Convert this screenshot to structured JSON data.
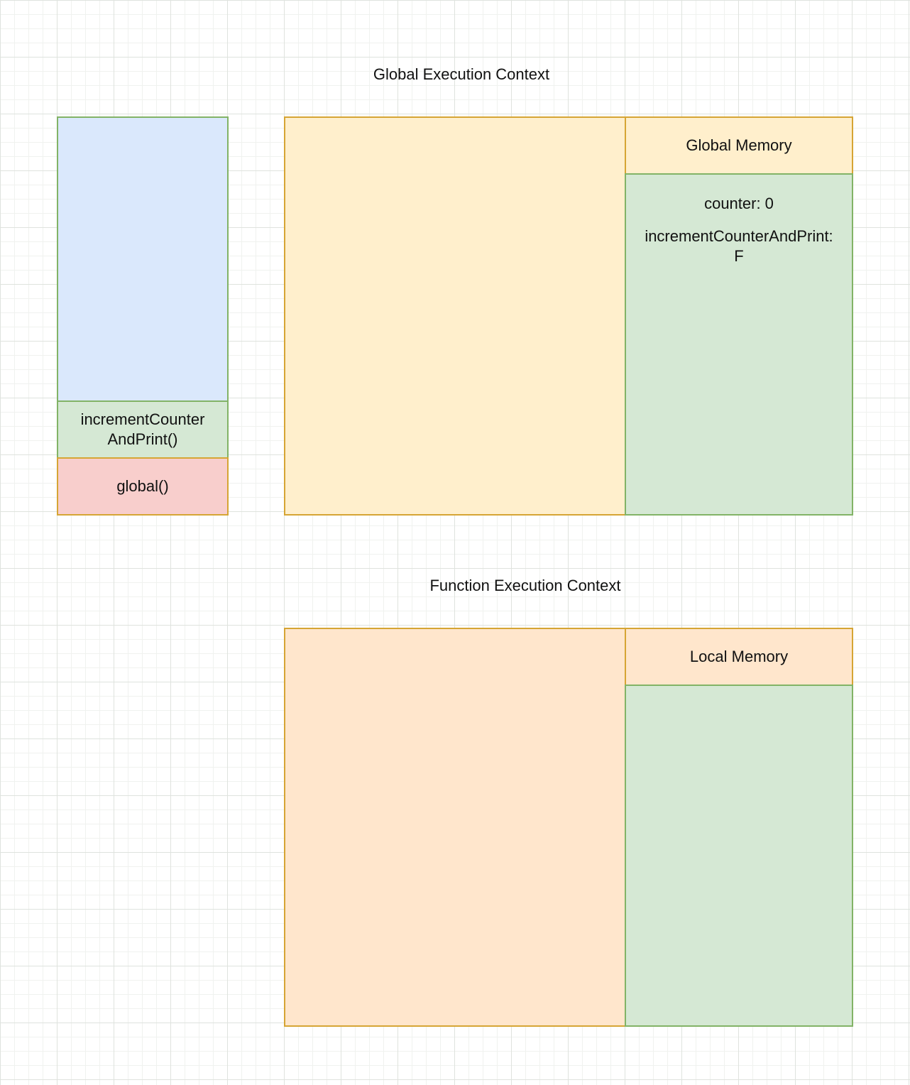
{
  "global_context": {
    "title": "Global Execution Context",
    "memory_header": "Global Memory",
    "memory_entries": [
      "counter: 0",
      "incrementCounterAndPrint:\nF"
    ]
  },
  "call_stack": {
    "frames": [
      "incrementCounter\nAndPrint()",
      "global()"
    ]
  },
  "function_context": {
    "title": "Function Execution Context",
    "memory_header": "Local Memory"
  },
  "colors": {
    "stack_empty": "#dae8fc",
    "stack_function_frame": "#d5e8d4",
    "stack_global_frame": "#f8cecc",
    "global_context_body": "#ffefcc",
    "function_context_body": "#ffe6cc",
    "memory_body": "#d5e8d4",
    "green_border": "#82b366",
    "orange_border": "#d6a534"
  }
}
